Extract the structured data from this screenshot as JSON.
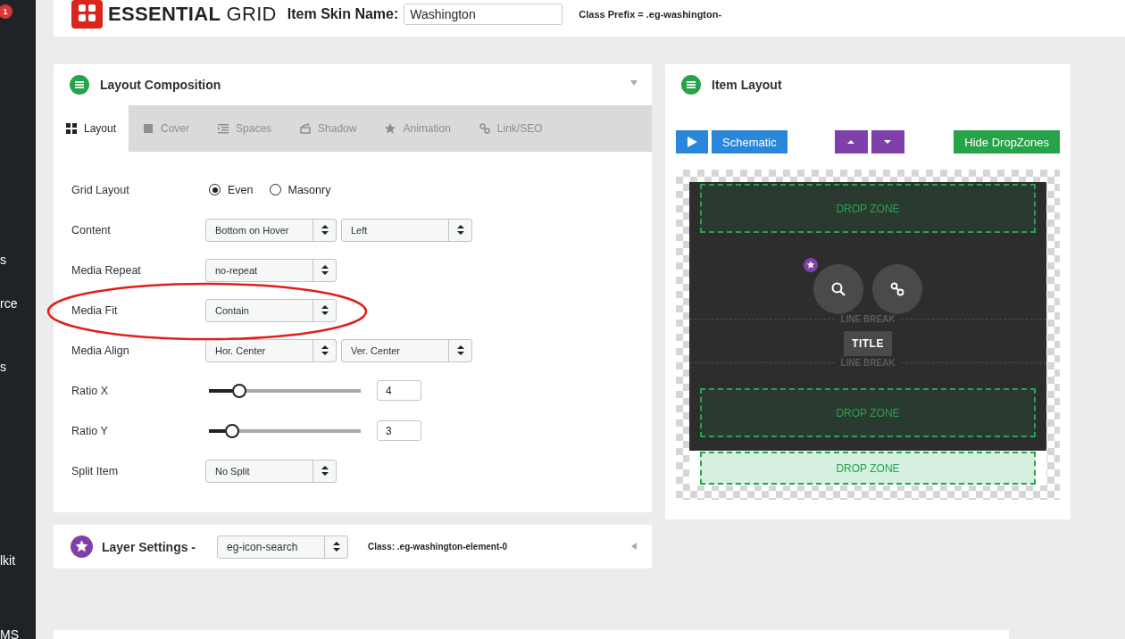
{
  "sidebar": {
    "badge": "1",
    "items": [
      "s",
      "rce",
      "s",
      "lkit",
      "MS"
    ]
  },
  "header": {
    "logo_text": "**ESSENTIAL** GRID",
    "skin_name_label": "Item Skin Name:",
    "skin_name_value": "Washington",
    "class_prefix": "Class Prefix = .eg-washington-"
  },
  "layout_panel": {
    "title": "Layout Composition",
    "tabs": [
      {
        "label": "Layout",
        "selected": true
      },
      {
        "label": "Cover",
        "selected": false
      },
      {
        "label": "Spaces",
        "selected": false
      },
      {
        "label": "Shadow",
        "selected": false
      },
      {
        "label": "Animation",
        "selected": false
      },
      {
        "label": "Link/SEO",
        "selected": false
      }
    ],
    "rows": [
      {
        "kind": "radio",
        "label": "Grid Layout",
        "options": [
          {
            "label": "Even",
            "selected": true
          },
          {
            "label": "Masonry",
            "selected": false
          }
        ]
      },
      {
        "kind": "select",
        "label": "Content",
        "values": [
          "Bottom on Hover",
          "Left"
        ]
      },
      {
        "kind": "select",
        "label": "Media Repeat",
        "values": [
          "no-repeat"
        ]
      },
      {
        "kind": "select",
        "label": "Media Fit",
        "values": [
          "Contain"
        ]
      },
      {
        "kind": "select",
        "label": "Media Align",
        "values": [
          "Hor. Center",
          "Ver. Center"
        ]
      },
      {
        "kind": "slider",
        "label": "Ratio X",
        "level": 0.2,
        "value": "4"
      },
      {
        "kind": "slider",
        "label": "Ratio Y",
        "level": 0.15,
        "value": "3"
      },
      {
        "kind": "select",
        "label": "Split Item",
        "values": [
          "No Split"
        ]
      }
    ]
  },
  "item_layout": {
    "title": "Item Layout",
    "schematic_button": "Schematic",
    "hide_button": "Hide DropZones",
    "drop_zones": [
      "DROP ZONE",
      "DROP ZONE",
      "DROP ZONE"
    ],
    "line_breaks": [
      "LINE BREAK",
      "LINE BREAK"
    ],
    "title_element": "TITLE"
  },
  "layer_settings": {
    "title": "Layer Settings -",
    "select": "eg-icon-search",
    "class_text": "Class: .eg-washington-element-0"
  }
}
